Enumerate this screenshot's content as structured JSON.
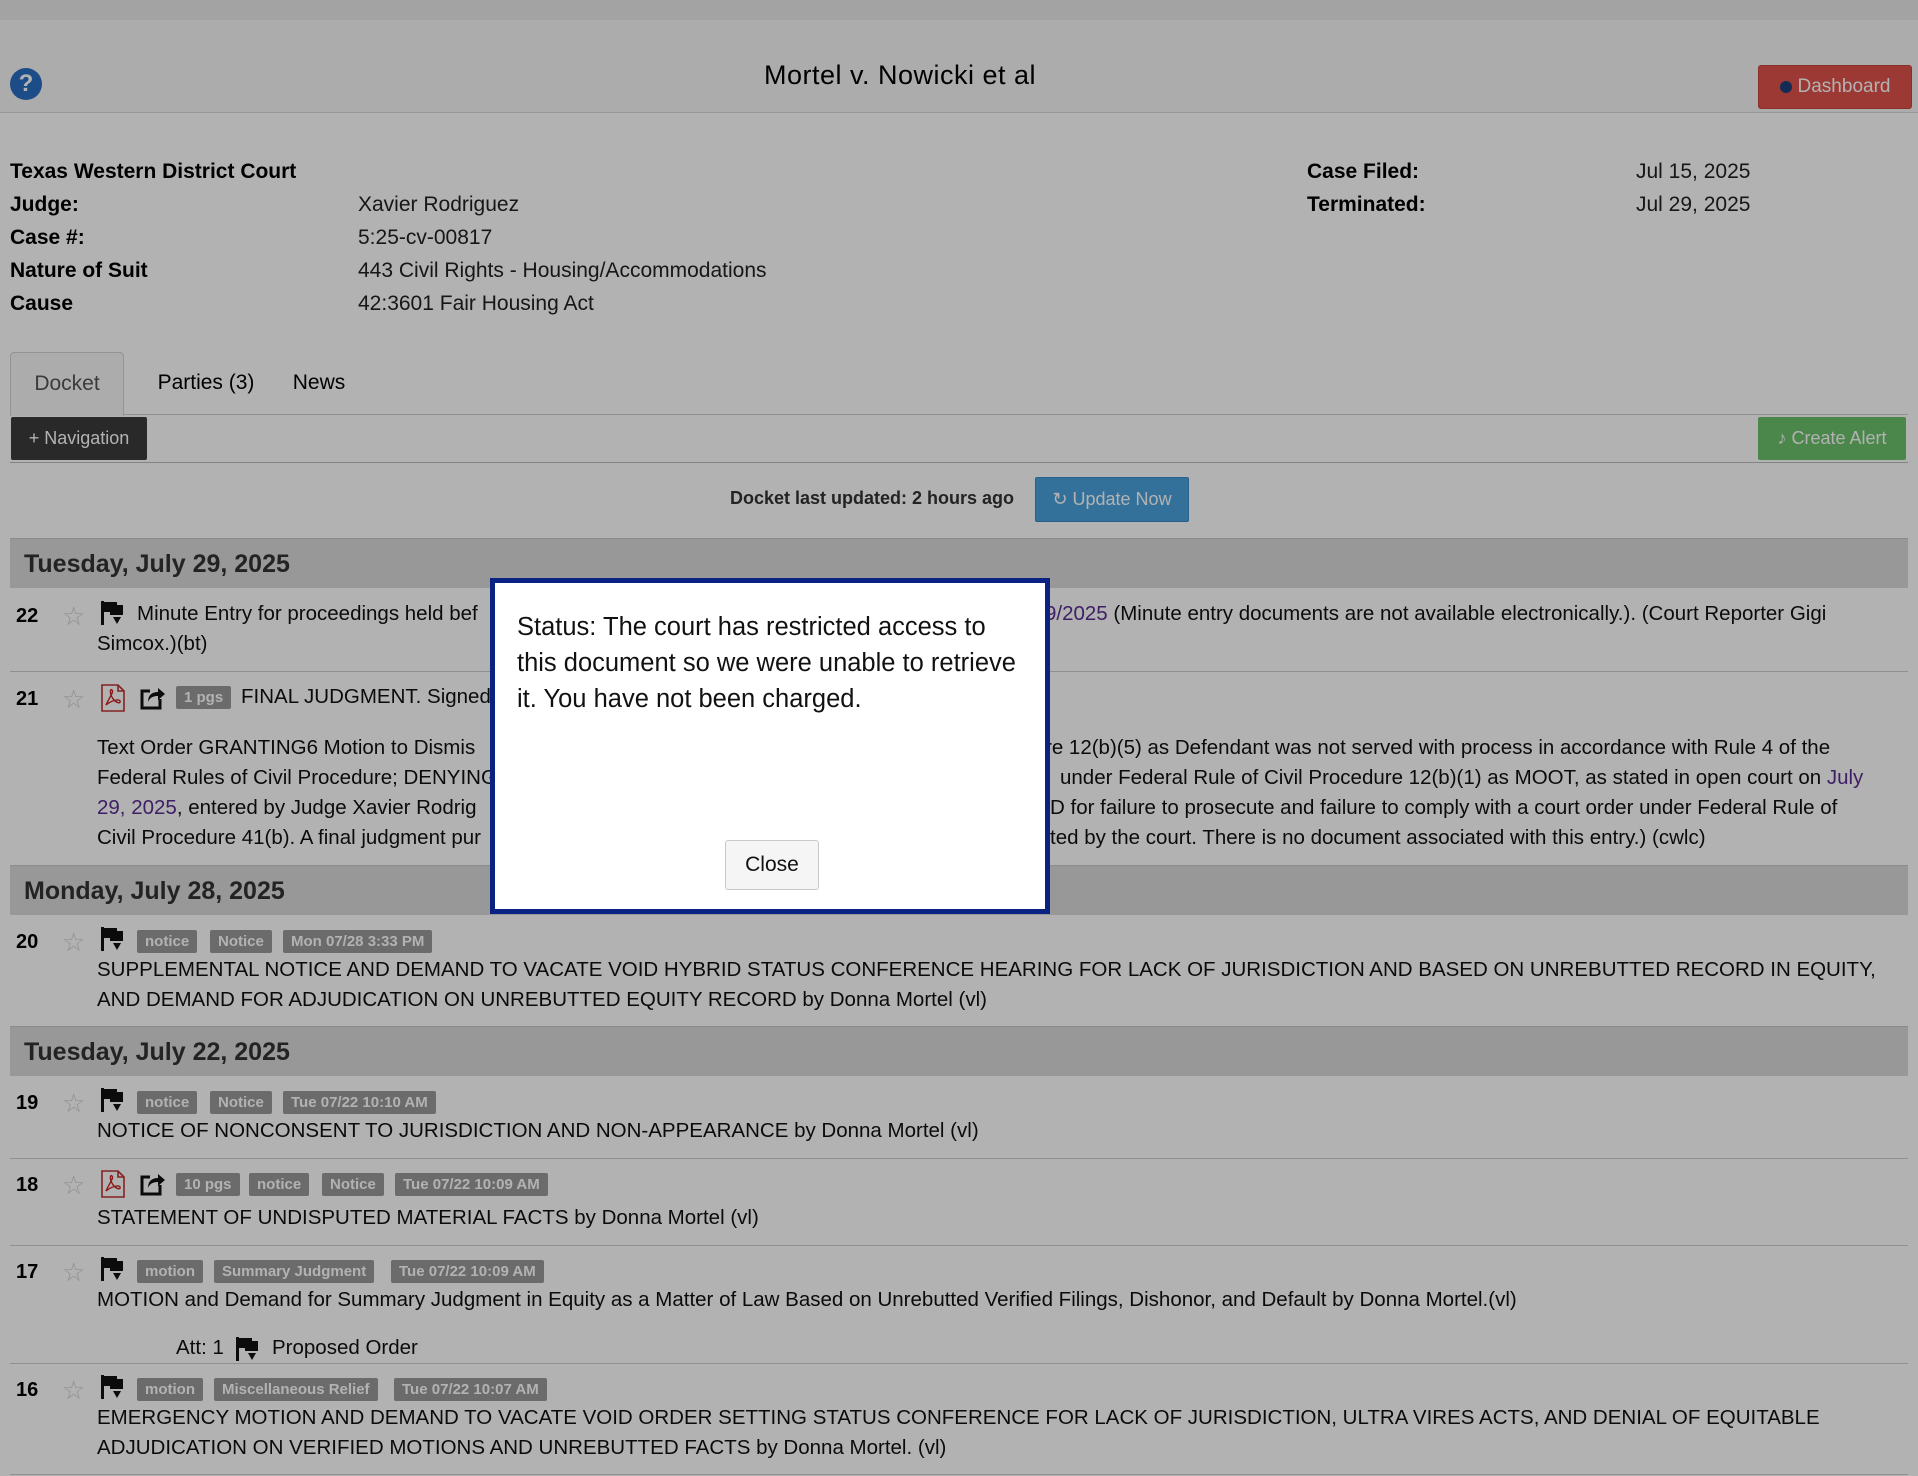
{
  "header": {
    "title": "Mortel v. Nowicki et al",
    "dashboard_label": "Dashboard",
    "help_glyph": "?"
  },
  "case_info": {
    "court": "Texas Western District Court",
    "judge_label": "Judge:",
    "judge": "Xavier Rodriguez",
    "case_no_label": "Case #:",
    "case_no": "5:25-cv-00817",
    "nature_label": "Nature of Suit",
    "nature": "443 Civil Rights - Housing/Accommodations",
    "cause_label": "Cause",
    "cause": "42:3601 Fair Housing Act",
    "filed_label": "Case Filed:",
    "filed": "Jul 15, 2025",
    "terminated_label": "Terminated:",
    "terminated": "Jul 29, 2025"
  },
  "tabs": [
    {
      "label": "Docket",
      "active": true
    },
    {
      "label": "Parties (3)",
      "active": false
    },
    {
      "label": "News",
      "active": false
    }
  ],
  "toolbar": {
    "navigation_label": "+ Navigation",
    "create_alert_label": "Create Alert"
  },
  "docket_status": {
    "updated_text": "Docket last updated: 2 hours ago",
    "update_now_label": "Update Now"
  },
  "date_groups": [
    "Tuesday, July 29, 2025",
    "Monday, July 28, 2025",
    "Tuesday, July 22, 2025"
  ],
  "entries": {
    "e22": {
      "num": "22",
      "line1_a": "Minute Entry for proceedings held bef",
      "line1_link": "9/2025",
      "line1_b": " (Minute entry documents are not available electronically.). (Court Reporter Gigi",
      "line2": "Simcox.)(bt)"
    },
    "e21": {
      "num": "21",
      "pages": "1 pgs",
      "title": "FINAL JUDGMENT. Signed",
      "text1_a": " Text Order GRANTING6 Motion to Dismis",
      "text1_b": "re 12(b)(5) as Defendant was not served with process in accordance with Rule 4 of the",
      "text2_a": "Federal Rules of Civil Procedure; DENYING",
      "text2_b": "under Federal Rule of Civil Procedure 12(b)(1) as MOOT, as stated in open court on ",
      "text2_link": "July",
      "text3_link": "29, 2025",
      "text3_a": ", entered by Judge Xavier Rodrig",
      "text3_b": "D for failure to prosecute and failure to comply with a court order under Federal Rule of",
      "text4_a": "Civil Procedure 41(b). A final judgment pur",
      "text4_b": "ted by the court. There is no document associated with this entry.) (cwlc)"
    },
    "e20": {
      "num": "20",
      "badges": [
        "notice",
        "Notice",
        "Mon 07/28 3:33 PM"
      ],
      "line1": "SUPPLEMENTAL NOTICE AND DEMAND TO VACATE VOID HYBRID STATUS CONFERENCE HEARING FOR LACK OF JURISDICTION AND BASED ON UNREBUTTED RECORD IN EQUITY,",
      "line2": "AND DEMAND FOR ADJUDICATION ON UNREBUTTED EQUITY RECORD by Donna Mortel (vl)"
    },
    "e19": {
      "num": "19",
      "badges": [
        "notice",
        "Notice",
        "Tue 07/22 10:10 AM"
      ],
      "line1": "NOTICE OF NONCONSENT TO JURISDICTION AND NON-APPEARANCE by Donna Mortel (vl)"
    },
    "e18": {
      "num": "18",
      "badges": [
        "10 pgs",
        "notice",
        "Notice",
        "Tue 07/22 10:09 AM"
      ],
      "line1": "STATEMENT OF UNDISPUTED MATERIAL FACTS by Donna Mortel (vl)"
    },
    "e17": {
      "num": "17",
      "badges": [
        "motion",
        "Summary Judgment",
        "Tue 07/22 10:09 AM"
      ],
      "line1": "MOTION and Demand for Summary Judgment in Equity as a Matter of Law Based on Unrebutted Verified Filings, Dishonor, and Default by Donna Mortel.(vl)",
      "att_label": "Att: 1",
      "att_name": "Proposed Order"
    },
    "e16": {
      "num": "16",
      "badges": [
        "motion",
        "Miscellaneous Relief",
        "Tue 07/22 10:07 AM"
      ],
      "line1": "EMERGENCY MOTION AND DEMAND TO VACATE VOID ORDER SETTING STATUS CONFERENCE FOR LACK OF JURISDICTION, ULTRA VIRES ACTS, AND DENIAL OF EQUITABLE",
      "line2": "ADJUDICATION ON VERIFIED MOTIONS AND UNREBUTTED FACTS by Donna Mortel. (vl)"
    }
  },
  "modal": {
    "message": "Status: The court has restricted access to this document so we were unable to retrieve it. You have not been charged.",
    "close_label": "Close"
  },
  "colors": {
    "modal_border": "#0a2282",
    "dashboard": "#e0524b",
    "create_alert": "#6cc26c",
    "update_now": "#4aa3df",
    "badge": "#9a9a9a",
    "link": "#5a2d91"
  },
  "icons": [
    "help-icon",
    "star-icon",
    "pacer-flag-icon",
    "pdf-icon",
    "share-icon",
    "bell-icon",
    "refresh-icon"
  ]
}
